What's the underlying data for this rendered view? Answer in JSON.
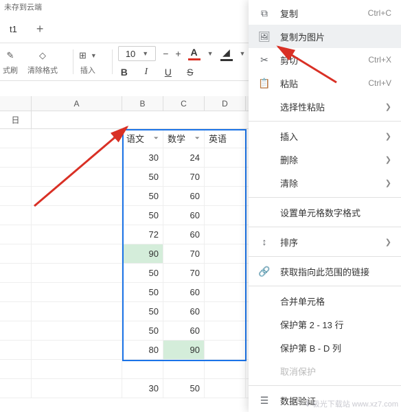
{
  "status_text": "未存到云端",
  "sheet_tab": "t1",
  "toolbar": {
    "format_brush": "式刷",
    "clear_format": "清除格式",
    "insert": "插入",
    "font_size": "10",
    "bold": "B",
    "italic": "I",
    "underline": "U",
    "strike": "S",
    "text_color_char": "A",
    "fill_color_char": "A"
  },
  "columns": {
    "A": "A",
    "B": "B",
    "C": "C",
    "D": "D"
  },
  "formula_cell": "日",
  "table": {
    "headers": [
      "语文",
      "数学",
      "英语"
    ],
    "rows": [
      {
        "b": 30,
        "c": 24,
        "d": ""
      },
      {
        "b": 50,
        "c": 70,
        "d": ""
      },
      {
        "b": 50,
        "c": 60,
        "d": ""
      },
      {
        "b": 50,
        "c": 60,
        "d": ""
      },
      {
        "b": 72,
        "c": 60,
        "d": ""
      },
      {
        "b": 90,
        "c": 70,
        "d": "",
        "b_hl": true
      },
      {
        "b": 50,
        "c": 70,
        "d": ""
      },
      {
        "b": 50,
        "c": 60,
        "d": ""
      },
      {
        "b": 50,
        "c": 60,
        "d": ""
      },
      {
        "b": 50,
        "c": 60,
        "d": ""
      },
      {
        "b": 80,
        "c": 90,
        "d": "",
        "c_hl": true
      }
    ],
    "extra_row": {
      "b": 30,
      "c": 50
    }
  },
  "context_menu": {
    "copy": "复制",
    "copy_shortcut": "Ctrl+C",
    "copy_as_image": "复制为图片",
    "cut": "剪切",
    "cut_shortcut": "Ctrl+X",
    "paste": "粘贴",
    "paste_shortcut": "Ctrl+V",
    "paste_special": "选择性粘贴",
    "insert": "插入",
    "delete": "删除",
    "clear": "清除",
    "number_format": "设置单元格数字格式",
    "sort": "排序",
    "get_link": "获取指向此范围的链接",
    "merge_cells": "合并单元格",
    "protect_rows": "保护第 2 - 13 行",
    "protect_cols": "保护第 B - D 列",
    "unprotect": "取消保护",
    "data_validation": "数据验证"
  },
  "watermark": "极光下载站 www.xz7.com"
}
